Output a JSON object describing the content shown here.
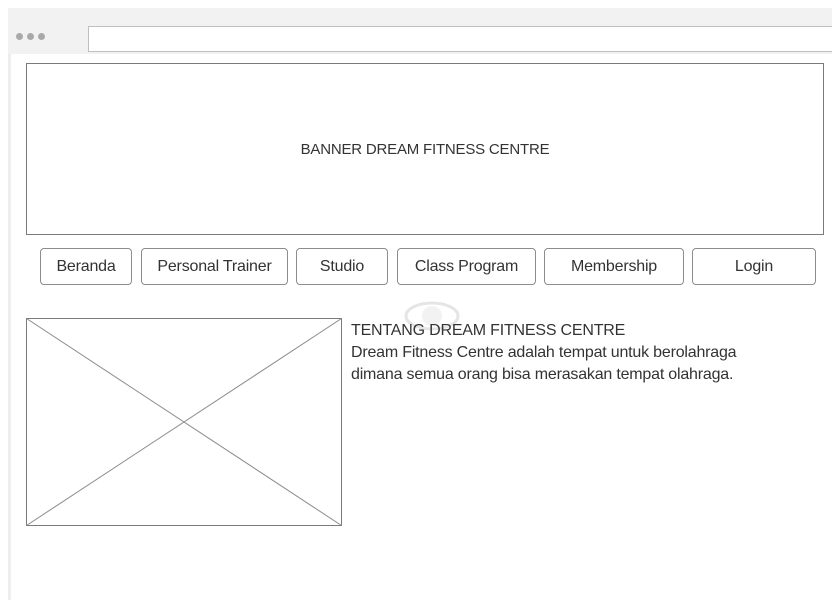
{
  "banner": {
    "text": "BANNER DREAM FITNESS CENTRE"
  },
  "nav": {
    "items": [
      {
        "label": "Beranda"
      },
      {
        "label": "Personal Trainer"
      },
      {
        "label": "Studio"
      },
      {
        "label": "Class Program"
      },
      {
        "label": "Membership"
      },
      {
        "label": "Login"
      }
    ]
  },
  "about": {
    "title": "TENTANG DREAM FITNESS CENTRE",
    "line1": "Dream Fitness Centre adalah tempat untuk berolahraga",
    "line2": "dimana semua orang bisa merasakan tempat olahraga."
  },
  "colors": {
    "border": "#7b7b7b",
    "chrome": "#f2f2f2",
    "text": "#333333"
  }
}
